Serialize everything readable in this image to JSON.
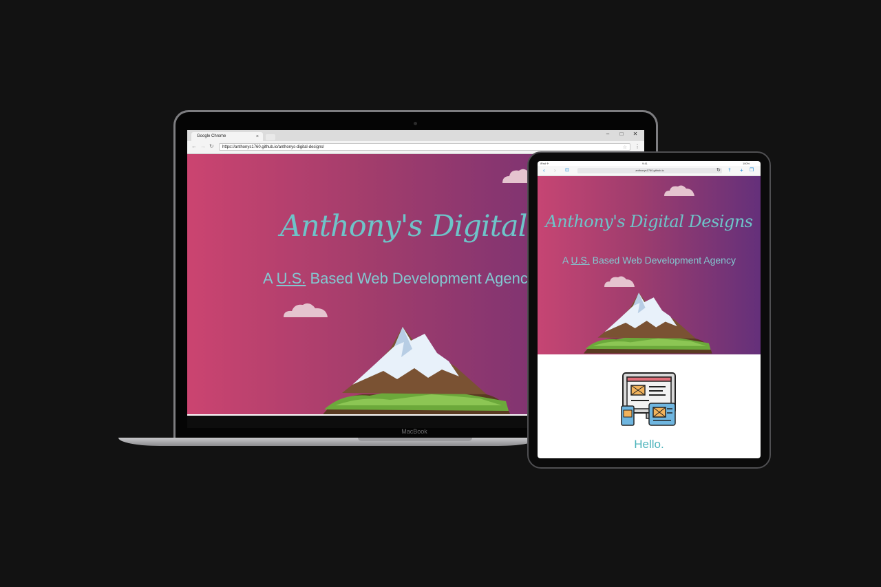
{
  "laptop": {
    "brand": "MacBook",
    "browser": {
      "tab_title": "Google Chrome",
      "tab_close": "×",
      "url": "https://anthonys1760.github.io/anthonys-digital-designs/",
      "window_controls": [
        "–",
        "□",
        "✕"
      ]
    },
    "page": {
      "title": "Anthony's Digital Designs",
      "subtitle_prefix": "A ",
      "subtitle_abbr": "U.S.",
      "subtitle_rest": " Based Web Development Agency"
    }
  },
  "tablet": {
    "status": {
      "left": "iPad ✈",
      "time": "9:41",
      "battery": "100%"
    },
    "url": "anthonys1760.github.io",
    "page": {
      "title": "Anthony's Digital Designs",
      "subtitle_prefix": "A ",
      "subtitle_abbr": "U.S.",
      "subtitle_rest": " Based Web Development Agency",
      "greeting": "Hello."
    }
  },
  "colors": {
    "gradient_start": "#cb4470",
    "gradient_end": "#6a2e75",
    "title_teal": "#6ec4c9",
    "greeting_teal": "#4cb3bb"
  },
  "icons": [
    "browser-back-icon",
    "browser-forward-icon",
    "reload-icon",
    "bookmark-star-icon",
    "menu-kebab-icon",
    "share-icon",
    "new-tab-plus-icon",
    "tabs-icon",
    "bookmarks-icon",
    "web-design-devices-icon"
  ]
}
